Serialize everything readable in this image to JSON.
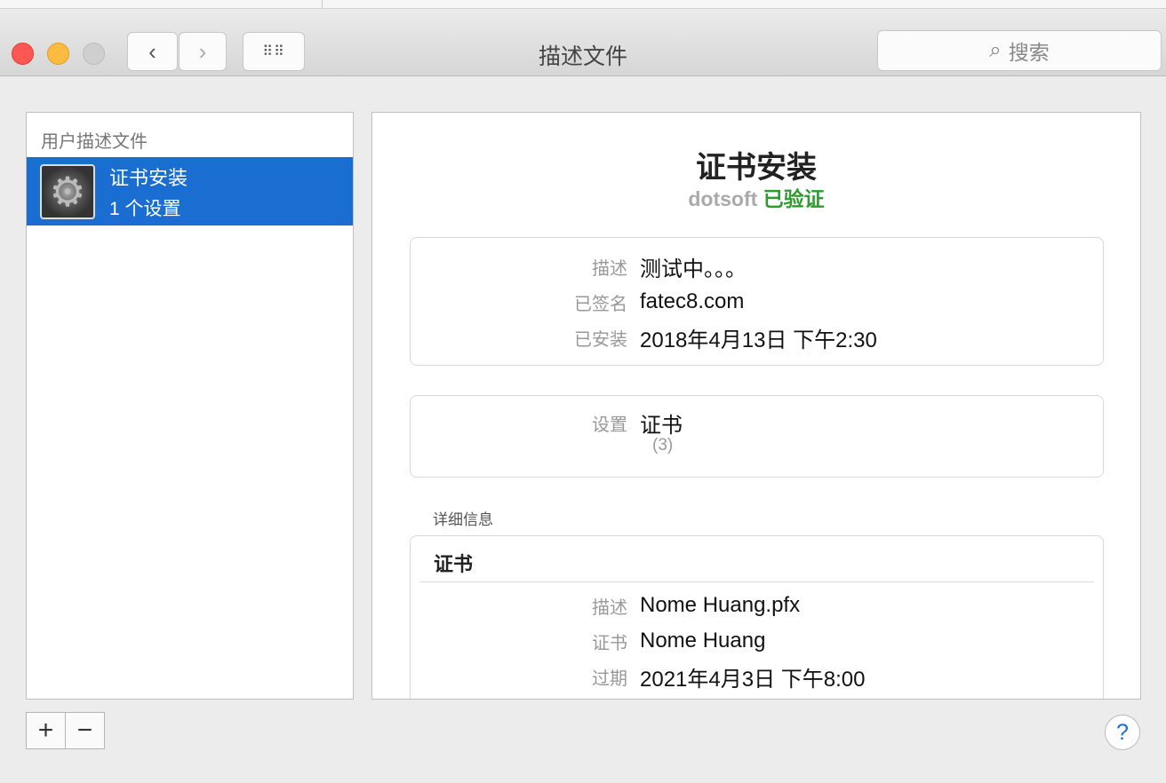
{
  "window": {
    "title": "描述文件",
    "search_placeholder": "搜索"
  },
  "colors": {
    "accent": "#1a6dd1",
    "verified": "#2f9a2f",
    "close": "#fc5753",
    "minimize": "#fdbc40",
    "zoom": "#cfcfcf"
  },
  "sidebar": {
    "header": "用户描述文件",
    "items": [
      {
        "name": "证书安装",
        "subtitle": "1 个设置",
        "icon": "gear-icon"
      }
    ]
  },
  "footer": {
    "add": "+",
    "remove": "−",
    "help": "?"
  },
  "detail": {
    "title": "证书安装",
    "org": "dotsoft",
    "status": "已验证",
    "info": [
      {
        "label": "描述",
        "value": "测试中。。。"
      },
      {
        "label": "已签名",
        "value": "fatec8.com"
      },
      {
        "label": "已安装",
        "value": "2018年4月13日 下午2:30"
      }
    ],
    "settings": {
      "label": "设置",
      "value": "证书",
      "count": "(3)"
    },
    "details_header": "详细信息",
    "cert": {
      "title": "证书",
      "rows": [
        {
          "label": "描述",
          "value": "Nome Huang.pfx"
        },
        {
          "label": "证书",
          "value": "Nome Huang"
        },
        {
          "label": "过期",
          "value": "2021年4月3日 下午8:00"
        }
      ]
    }
  }
}
